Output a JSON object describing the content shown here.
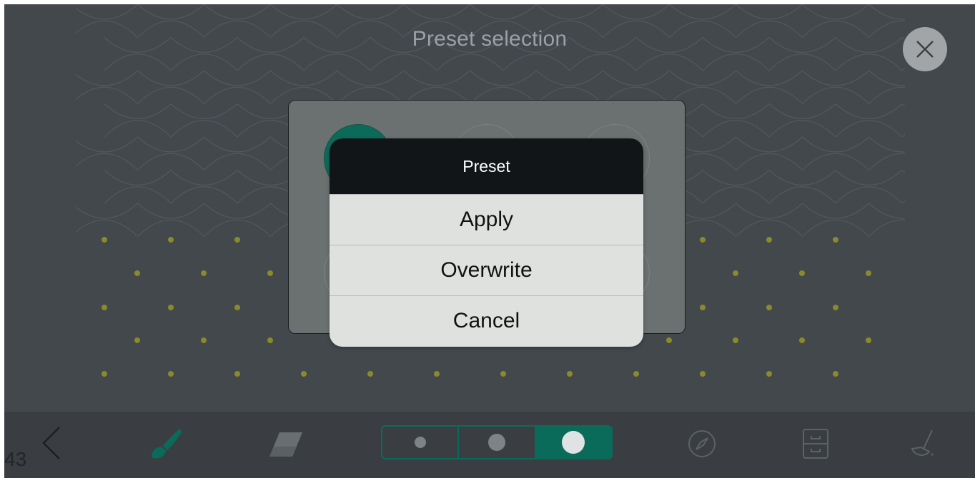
{
  "page_title": "Preset selection",
  "page_number": "43",
  "dialog": {
    "title": "Preset",
    "options": [
      "Apply",
      "Overwrite",
      "Cancel"
    ]
  },
  "toolbar": {
    "icons": [
      "back-chevron-icon",
      "brush-icon",
      "eraser-icon",
      "compass-icon",
      "storage-box-icon",
      "sweep-broom-icon"
    ],
    "brush_sizes": [
      "small",
      "medium",
      "large"
    ],
    "selected_size": "large"
  },
  "colors": {
    "background": "#43484d",
    "accent": "#0b6b5a",
    "dialog_header": "#111517",
    "dialog_body": "#dfe1df",
    "pattern_dots": "#8a8a2a"
  }
}
